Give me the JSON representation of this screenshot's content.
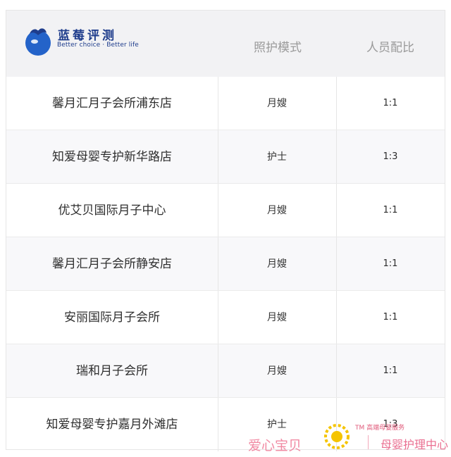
{
  "brand": {
    "name_cn": "蓝莓评测",
    "slogan": "Better choice · Better life",
    "colors": {
      "primary": "#1f3d8c",
      "blue": "#2463c9"
    }
  },
  "header": {
    "col_mode": "照护模式",
    "col_ratio": "人员配比"
  },
  "rows": [
    {
      "name": "馨月汇月子会所浦东店",
      "mode": "月嫂",
      "ratio": "1:1"
    },
    {
      "name": "知爱母婴专护新华路店",
      "mode": "护士",
      "ratio": "1:3"
    },
    {
      "name": "优艾贝国际月子中心",
      "mode": "月嫂",
      "ratio": "1:1"
    },
    {
      "name": "馨月汇月子会所静安店",
      "mode": "月嫂",
      "ratio": "1:1"
    },
    {
      "name": "安丽国际月子会所",
      "mode": "月嫂",
      "ratio": "1:1"
    },
    {
      "name": "瑞和月子会所",
      "mode": "月嫂",
      "ratio": "1:1"
    },
    {
      "name": "知爱母婴专护嘉月外滩店",
      "mode": "护士",
      "ratio": "1:3"
    }
  ],
  "watermark": {
    "name_cn": "爱心宝贝",
    "tagline": "TM 高端母婴服务",
    "service": "母婴护理中心",
    "colors": {
      "pink": "#f18aa3",
      "yellow": "#f5c400"
    }
  }
}
